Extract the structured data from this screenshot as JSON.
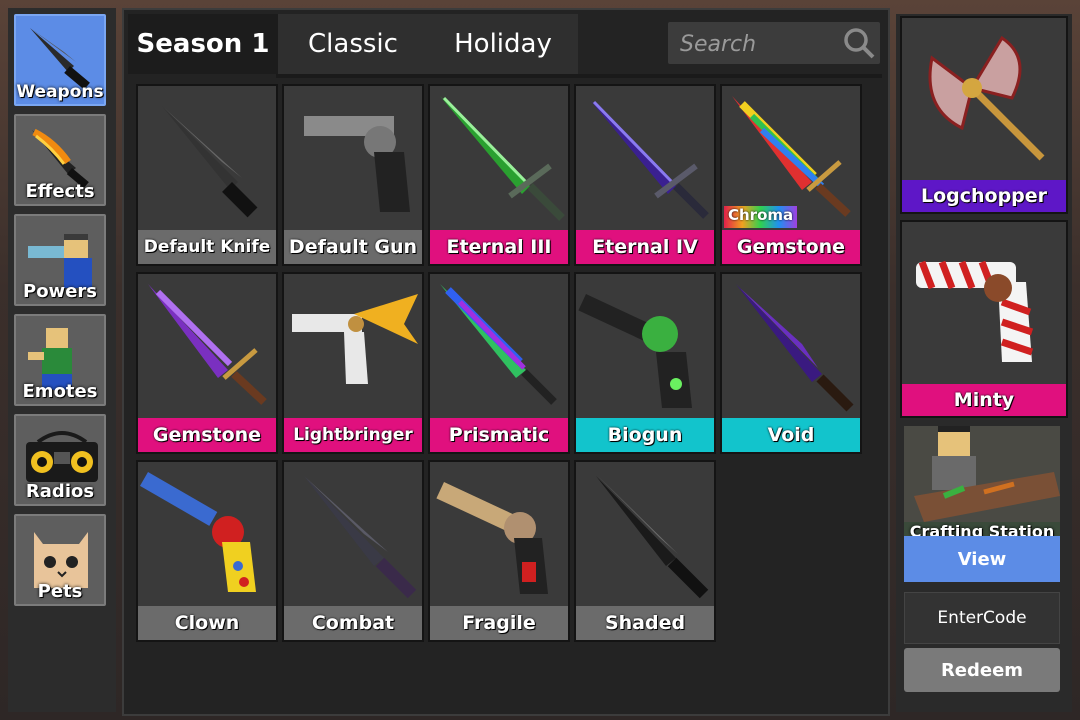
{
  "colors": {
    "accent_blue": "#5c8ce6",
    "legendary_pink": "#e0107e",
    "ancient_purple": "#5e17c7",
    "unique_cyan": "#12c4cc",
    "common_gray": "#6b6b6b"
  },
  "sidebar": {
    "items": [
      {
        "label": "Weapons",
        "icon": "knife-icon",
        "active": true
      },
      {
        "label": "Effects",
        "icon": "fire-knife-icon",
        "active": false
      },
      {
        "label": "Powers",
        "icon": "power-character-icon",
        "active": false
      },
      {
        "label": "Emotes",
        "icon": "emote-character-icon",
        "active": false
      },
      {
        "label": "Radios",
        "icon": "boombox-icon",
        "active": false
      },
      {
        "label": "Pets",
        "icon": "cat-pet-icon",
        "active": false
      }
    ]
  },
  "tabs": [
    {
      "label": "Season 1",
      "active": true
    },
    {
      "label": "Classic",
      "active": false
    },
    {
      "label": "Holiday",
      "active": false
    }
  ],
  "search": {
    "placeholder": "Search",
    "icon": "search-icon"
  },
  "items": [
    {
      "name": "Default Knife",
      "rarity": "common",
      "color": "#6b6b6b",
      "icon": "knife-icon"
    },
    {
      "name": "Default Gun",
      "rarity": "common",
      "color": "#6b6b6b",
      "icon": "revolver-icon"
    },
    {
      "name": "Eternal III",
      "rarity": "legendary",
      "color": "#e0107e",
      "icon": "green-sword-icon"
    },
    {
      "name": "Eternal IV",
      "rarity": "legendary",
      "color": "#e0107e",
      "icon": "purple-sword-icon"
    },
    {
      "name": "Gemstone",
      "rarity": "chroma",
      "color": "#e0107e",
      "icon": "rainbow-gem-knife-icon",
      "tag": "Chroma"
    },
    {
      "name": "Gemstone",
      "rarity": "legendary",
      "color": "#e0107e",
      "icon": "purple-gem-knife-icon"
    },
    {
      "name": "Lightbringer",
      "rarity": "legendary",
      "color": "#e0107e",
      "icon": "winged-gun-icon"
    },
    {
      "name": "Prismatic",
      "rarity": "legendary",
      "color": "#e0107e",
      "icon": "prismatic-blade-icon"
    },
    {
      "name": "Biogun",
      "rarity": "unique",
      "color": "#12c4cc",
      "icon": "bio-revolver-icon"
    },
    {
      "name": "Void",
      "rarity": "unique",
      "color": "#12c4cc",
      "icon": "void-knife-icon"
    },
    {
      "name": "Clown",
      "rarity": "common",
      "color": "#6b6b6b",
      "icon": "clown-gun-icon"
    },
    {
      "name": "Combat",
      "rarity": "common",
      "color": "#6b6b6b",
      "icon": "combat-knife-icon"
    },
    {
      "name": "Fragile",
      "rarity": "common",
      "color": "#6b6b6b",
      "icon": "fragile-gun-icon"
    },
    {
      "name": "Shaded",
      "rarity": "common",
      "color": "#6b6b6b",
      "icon": "shaded-knife-icon"
    }
  ],
  "featured": [
    {
      "name": "Logchopper",
      "color": "#5e17c7",
      "icon": "candy-axe-icon"
    },
    {
      "name": "Minty",
      "color": "#e0107e",
      "icon": "candy-cane-gun-icon"
    }
  ],
  "crafting": {
    "label": "Crafting Station",
    "view_label": "View"
  },
  "code": {
    "placeholder": "EnterCode",
    "redeem_label": "Redeem"
  }
}
